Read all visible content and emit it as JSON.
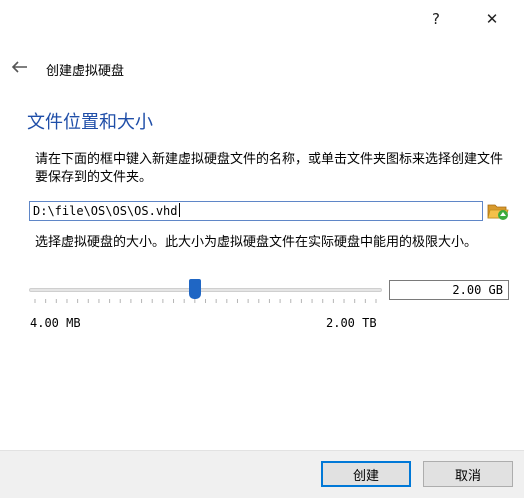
{
  "titlebar": {
    "help_label": "?",
    "close_label": "✕",
    "icons": {
      "help": "question-mark-icon",
      "close": "close-icon"
    }
  },
  "header": {
    "back_icon": "back-arrow-icon",
    "wizard_title": "创建虚拟硬盘"
  },
  "main": {
    "section_title": "文件位置和大小",
    "location_description": "请在下面的框中键入新建虚拟硬盘文件的名称，或单击文件夹图标来选择创建文件要保存到的文件夹。",
    "file_path_value": "D:\\file\\OS\\OS\\OS.vhd",
    "folder_icon": "folder-open-icon",
    "size_description": "选择虚拟硬盘的大小。此大小为虚拟硬盘文件在实际硬盘中能用的极限大小。",
    "size_slider": {
      "value_fraction": 0.47
    },
    "size_value": "2.00 GB",
    "range_min_label": "4.00 MB",
    "range_max_label": "2.00 TB"
  },
  "footer": {
    "create_label": "创建",
    "cancel_label": "取消"
  },
  "colors": {
    "section_title": "#1f4ea8",
    "accent": "#1f66c4",
    "focus_border": "#0078d7",
    "footer_bg": "#f0f0f0"
  }
}
